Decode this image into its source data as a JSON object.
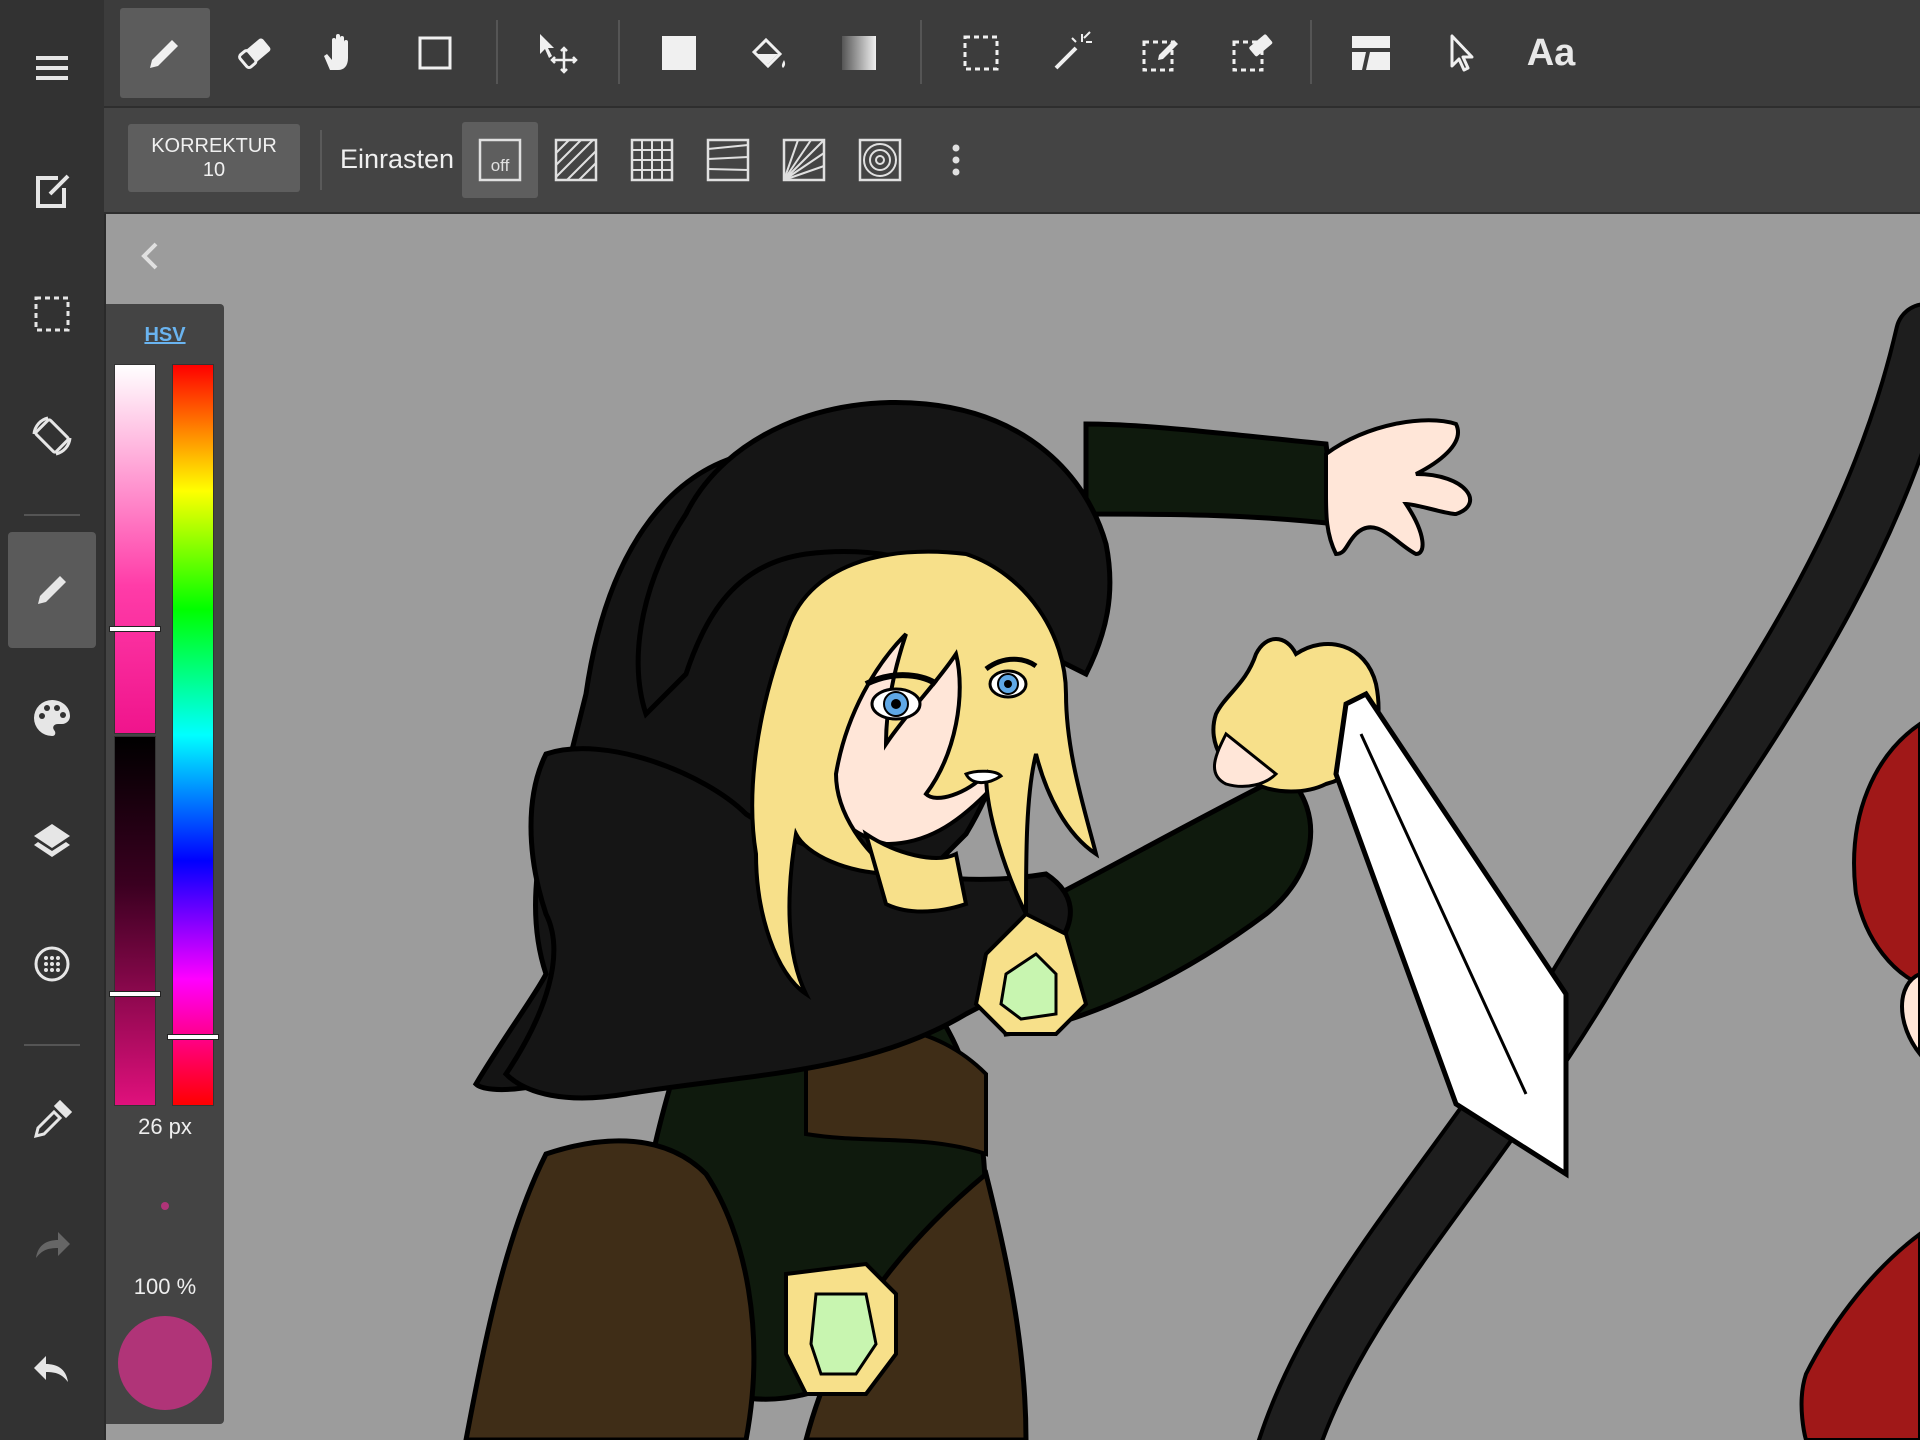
{
  "sidebar": {
    "items": [
      {
        "name": "menu-icon"
      },
      {
        "name": "new-canvas-icon"
      },
      {
        "name": "selection-icon"
      },
      {
        "name": "rotate-screen-icon"
      },
      {
        "name": "pen-icon",
        "active": true
      },
      {
        "name": "palette-icon"
      },
      {
        "name": "layers-icon"
      },
      {
        "name": "material-icon"
      },
      {
        "name": "eyedropper-icon"
      },
      {
        "name": "redo-icon"
      },
      {
        "name": "undo-icon"
      }
    ]
  },
  "toolbar": {
    "tools": [
      {
        "name": "pen-tool-icon",
        "active": true
      },
      {
        "name": "eraser-tool-icon"
      },
      {
        "name": "hand-tool-icon"
      },
      {
        "name": "shape-tool-icon"
      },
      {
        "name": "move-tool-icon"
      },
      {
        "name": "fill-rectangle-icon"
      },
      {
        "name": "bucket-icon"
      },
      {
        "name": "gradient-icon"
      },
      {
        "name": "select-rect-icon"
      },
      {
        "name": "magic-wand-icon"
      },
      {
        "name": "select-pen-icon"
      },
      {
        "name": "select-eraser-icon"
      },
      {
        "name": "panel-divide-icon"
      },
      {
        "name": "operation-cursor-icon"
      }
    ],
    "text_tool_label": "Aa"
  },
  "subbar": {
    "correction_label": "KORREKTUR",
    "correction_value": "10",
    "snap_label": "Einrasten",
    "snap_off_label": "off",
    "snap_modes": [
      {
        "name": "snap-off-icon",
        "active": true
      },
      {
        "name": "snap-parallel-icon"
      },
      {
        "name": "snap-grid-icon"
      },
      {
        "name": "snap-perspective-icon"
      },
      {
        "name": "snap-radial-icon"
      },
      {
        "name": "snap-circle-icon"
      },
      {
        "name": "more-options-icon"
      }
    ]
  },
  "color_panel": {
    "mode_label": "HSV",
    "saturation_level": 0.72,
    "value_level": 0.7,
    "hue_level": 0.91,
    "brush_size_label": "26 px",
    "opacity_label": "100 %",
    "current_color": "#b03478"
  },
  "colors": {
    "canvas_bg": "#9c9c9c",
    "panel_bg": "#444444",
    "toolbar_bg": "#3c3c3c",
    "accent_hsv": "#6ab4f0"
  }
}
